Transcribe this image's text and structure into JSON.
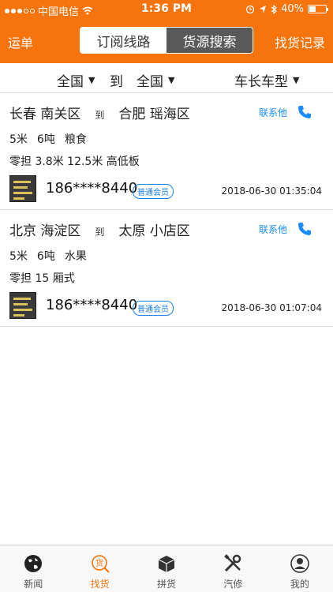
{
  "status": {
    "carrier": "中国电信",
    "time": "1:36 PM",
    "battery": "40%",
    "battery_level": 0.4
  },
  "nav": {
    "left": "运单",
    "tabs": [
      "订阅线路",
      "货源搜索"
    ],
    "active_tab": 1,
    "right": "找货记录"
  },
  "filter": {
    "from": "全国",
    "to_label": "到",
    "to": "全国",
    "vehicle": "车长车型"
  },
  "listings": [
    {
      "from": "长春 南关区",
      "to_label": "到",
      "to": "合肥 瑶海区",
      "contact_label": "联系他",
      "length": "5米",
      "weight": "6吨",
      "cargo": "粮食",
      "detail": "零担 3.8米 12.5米 高低板",
      "phone": "186****8440",
      "badge": "普通会员",
      "time": "2018-06-30 01:35:04"
    },
    {
      "from": "北京 海淀区",
      "to_label": "到",
      "to": "太原 小店区",
      "contact_label": "联系他",
      "length": "5米",
      "weight": "6吨",
      "cargo": "水果",
      "detail": "零担 15 厢式",
      "phone": "186****8440",
      "badge": "普通会员",
      "time": "2018-06-30 01:07:04"
    }
  ],
  "tabbar": {
    "items": [
      "新闻",
      "找货",
      "拼货",
      "汽修",
      "我的"
    ],
    "active": 1,
    "active_icon_text": "货"
  },
  "colors": {
    "accent": "#F7730B",
    "link": "#1a8cff"
  },
  "icons": [
    "wifi-icon",
    "lock-icon",
    "location-icon",
    "bluetooth-icon",
    "phone-icon",
    "globe-icon",
    "box-icon",
    "tools-icon",
    "user-icon"
  ]
}
